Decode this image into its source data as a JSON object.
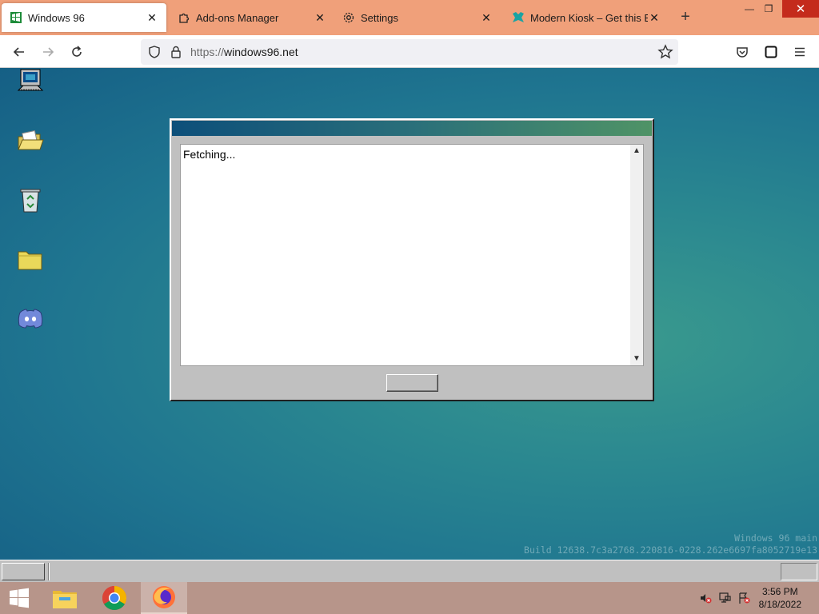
{
  "browser": {
    "tabs": [
      {
        "label": "Windows 96",
        "icon": "windows96-icon",
        "active": true
      },
      {
        "label": "Add-ons Manager",
        "icon": "puzzle-icon",
        "active": false
      },
      {
        "label": "Settings",
        "icon": "gear-icon",
        "active": false
      },
      {
        "label": "Modern Kiosk – Get this Exte",
        "icon": "kiosk-icon",
        "active": false
      }
    ],
    "url_protocol": "https://",
    "url_host": "windows96.net"
  },
  "desktop": {
    "icons": [
      "my-computer-icon",
      "open-folder-icon",
      "recycle-bin-icon",
      "folder-icon",
      "discord-icon"
    ],
    "build_line1": "Windows 96 main",
    "build_line2": "Build 12638.7c3a2768.220816-0228.262e6697fa8052719e13"
  },
  "dialog": {
    "text": "Fetching..."
  },
  "host_taskbar": {
    "apps": [
      "file-explorer-icon",
      "chrome-icon",
      "firefox-icon"
    ],
    "time": "3:56 PM",
    "date": "8/18/2022"
  },
  "colors": {
    "tabstrip": "#f0a07a",
    "desktop": "#1f6f87",
    "titlebar_start": "#0d4f7a",
    "titlebar_end": "#4f9366"
  }
}
